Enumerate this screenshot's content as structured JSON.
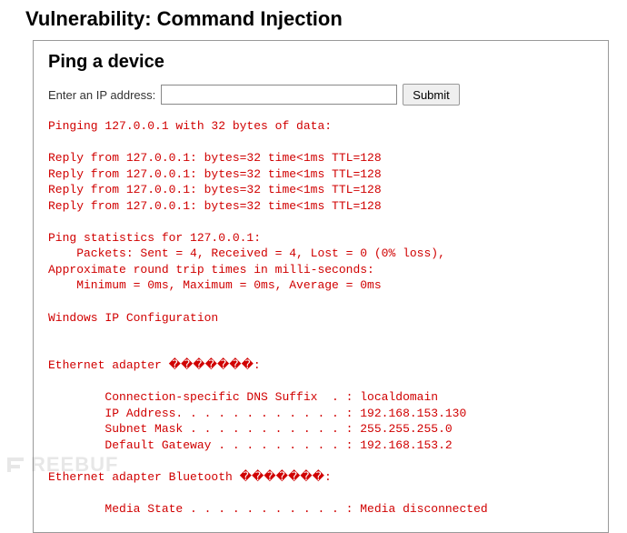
{
  "page": {
    "title": "Vulnerability: Command Injection"
  },
  "panel": {
    "heading": "Ping a device",
    "form": {
      "label": "Enter an IP address:",
      "ip_value": "",
      "submit_label": "Submit"
    },
    "output_lines": [
      "Pinging 127.0.0.1 with 32 bytes of data:",
      "",
      "Reply from 127.0.0.1: bytes=32 time<1ms TTL=128",
      "Reply from 127.0.0.1: bytes=32 time<1ms TTL=128",
      "Reply from 127.0.0.1: bytes=32 time<1ms TTL=128",
      "Reply from 127.0.0.1: bytes=32 time<1ms TTL=128",
      "",
      "Ping statistics for 127.0.0.1:",
      "    Packets: Sent = 4, Received = 4, Lost = 0 (0% loss),",
      "Approximate round trip times in milli-seconds:",
      "    Minimum = 0ms, Maximum = 0ms, Average = 0ms",
      "",
      "Windows IP Configuration",
      "",
      "",
      "Ethernet adapter �������:",
      "",
      "        Connection-specific DNS Suffix  . : localdomain",
      "        IP Address. . . . . . . . . . . . : 192.168.153.130",
      "        Subnet Mask . . . . . . . . . . . : 255.255.255.0",
      "        Default Gateway . . . . . . . . . : 192.168.153.2",
      "",
      "Ethernet adapter Bluetooth �������:",
      "",
      "        Media State . . . . . . . . . . . : Media disconnected"
    ]
  },
  "watermark": {
    "text": "REEBUF"
  }
}
